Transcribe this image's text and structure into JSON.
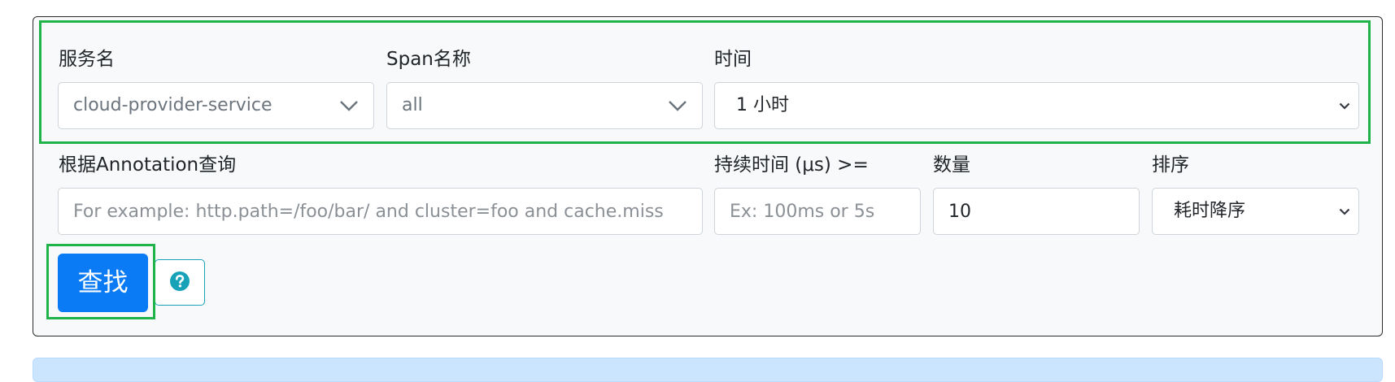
{
  "filters": {
    "service": {
      "label": "服务名",
      "value": "cloud-provider-service"
    },
    "span": {
      "label": "Span名称",
      "value": "all"
    },
    "time": {
      "label": "时间",
      "value": "1 小时"
    },
    "annotation": {
      "label": "根据Annotation查询",
      "placeholder": "For example: http.path=/foo/bar/ and cluster=foo and cache.miss"
    },
    "duration": {
      "label": "持续时间 (μs) >=",
      "placeholder": "Ex: 100ms or 5s"
    },
    "limit": {
      "label": "数量",
      "value": "10"
    },
    "sort": {
      "label": "排序",
      "value": "耗时降序"
    }
  },
  "actions": {
    "search_label": "查找",
    "help_icon": "question-circle-icon"
  },
  "colors": {
    "primary": "#0a7bf4",
    "info": "#17a2b8",
    "highlight": "#1fb34a",
    "alert_bg": "#cce5ff"
  }
}
